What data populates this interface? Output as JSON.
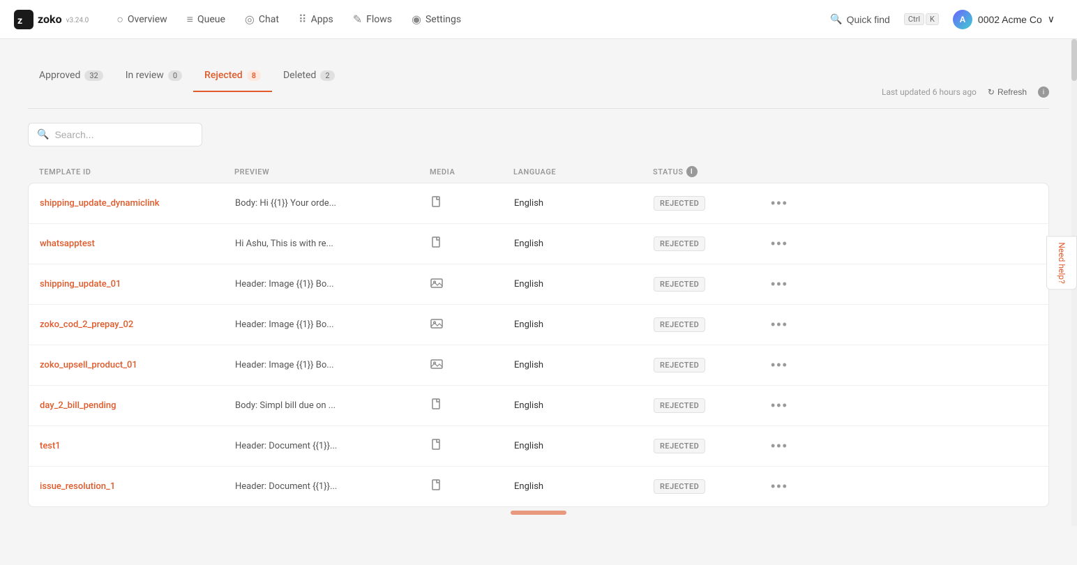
{
  "app": {
    "logo_text": "zoko",
    "logo_version": "v3.24.0"
  },
  "nav": {
    "items": [
      {
        "id": "overview",
        "label": "Overview",
        "icon": "○"
      },
      {
        "id": "queue",
        "label": "Queue",
        "icon": "≡"
      },
      {
        "id": "chat",
        "label": "Chat",
        "icon": "◎"
      },
      {
        "id": "apps",
        "label": "Apps",
        "icon": "⠿"
      },
      {
        "id": "flows",
        "label": "Flows",
        "icon": "✎"
      },
      {
        "id": "settings",
        "label": "Settings",
        "icon": "◉"
      }
    ],
    "quick_find_label": "Quick find",
    "kbd1": "Ctrl",
    "kbd2": "K",
    "account_name": "0002 Acme Co",
    "account_chevron": "∨"
  },
  "tabs": [
    {
      "id": "approved",
      "label": "Approved",
      "count": "32"
    },
    {
      "id": "in_review",
      "label": "In review",
      "count": "0"
    },
    {
      "id": "rejected",
      "label": "Rejected",
      "count": "8",
      "active": true
    },
    {
      "id": "deleted",
      "label": "Deleted",
      "count": "2"
    }
  ],
  "last_updated": "Last updated 6 hours ago",
  "refresh_label": "Refresh",
  "search": {
    "placeholder": "Search..."
  },
  "table": {
    "headers": [
      {
        "id": "template_id",
        "label": "TEMPLATE ID"
      },
      {
        "id": "preview",
        "label": "PREVIEW"
      },
      {
        "id": "media",
        "label": "MEDIA"
      },
      {
        "id": "language",
        "label": "LANGUAGE"
      },
      {
        "id": "status",
        "label": "STATUS"
      },
      {
        "id": "actions",
        "label": ""
      }
    ],
    "rows": [
      {
        "id": "shipping_update_dynamiclink",
        "preview": "Body: Hi {{1}} Your orde...",
        "media": "document",
        "language": "English",
        "status": "REJECTED"
      },
      {
        "id": "whatsapptest",
        "preview": "Hi Ashu, This is with re...",
        "media": "document",
        "language": "English",
        "status": "REJECTED"
      },
      {
        "id": "shipping_update_01",
        "preview": "Header: Image {{1}} Bo...",
        "media": "image",
        "language": "English",
        "status": "REJECTED"
      },
      {
        "id": "zoko_cod_2_prepay_02",
        "preview": "Header: Image {{1}} Bo...",
        "media": "image",
        "language": "English",
        "status": "REJECTED"
      },
      {
        "id": "zoko_upsell_product_01",
        "preview": "Header: Image {{1}} Bo...",
        "media": "image",
        "language": "English",
        "status": "REJECTED"
      },
      {
        "id": "day_2_bill_pending",
        "preview": "Body: Simpl bill due on ...",
        "media": "document",
        "language": "English",
        "status": "REJECTED"
      },
      {
        "id": "test1",
        "preview": "Header: Document {{1}}...",
        "media": "document",
        "language": "English",
        "status": "REJECTED"
      },
      {
        "id": "issue_resolution_1",
        "preview": "Header: Document {{1}}...",
        "media": "document",
        "language": "English",
        "status": "REJECTED"
      }
    ]
  },
  "need_help_label": "Need help?"
}
